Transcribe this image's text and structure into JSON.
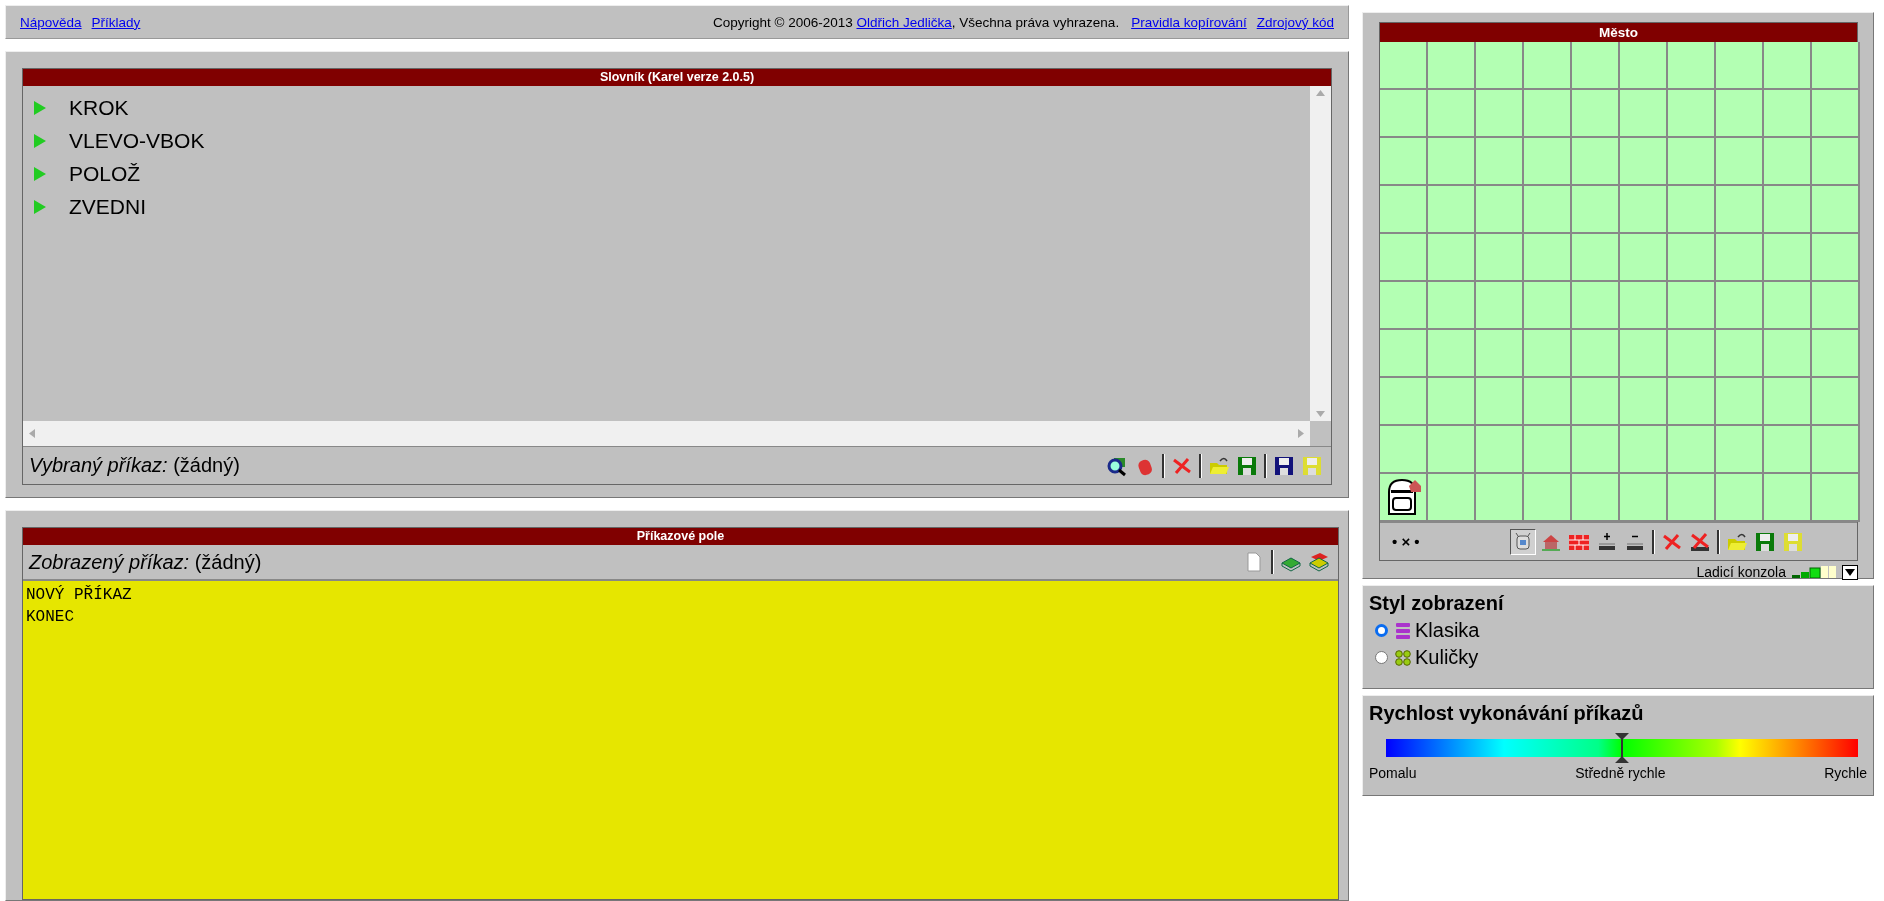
{
  "top_bar": {
    "links_left": [
      "Nápověda",
      "Příklady"
    ],
    "copyright_before": "Copyright © 2006-2013",
    "author_link": "Oldřich Jedlička",
    "copyright_after": ", Všechna práva vyhrazena.",
    "links_right": [
      "Pravidla kopírování",
      "Zdrojový kód"
    ]
  },
  "dictionary": {
    "title": "Slovník (Karel verze 2.0.5)",
    "items": [
      "KROK",
      "VLEVO-VBOK",
      "POLOŽ",
      "ZVEDNI"
    ],
    "selected_label": "*Vybraný příkaz:* (žádný)",
    "tools": [
      {
        "kind": "find"
      },
      {
        "kind": "eraser"
      },
      {
        "kind": "separator"
      },
      {
        "kind": "delete"
      },
      {
        "kind": "separator"
      },
      {
        "kind": "open"
      },
      {
        "kind": "save"
      },
      {
        "kind": "separator"
      },
      {
        "kind": "save-12"
      },
      {
        "kind": "save-k99"
      }
    ]
  },
  "command_field": {
    "title": "Příkazové pole",
    "shown_label": "*Zobrazený příkaz:* (žádný)",
    "tools": [
      {
        "kind": "new"
      },
      {
        "kind": "separator"
      },
      {
        "kind": "book"
      },
      {
        "kind": "books"
      }
    ],
    "value": "NOVÝ PŘÍKAZ\nKONEC"
  },
  "city": {
    "title": "Město",
    "position": "• × •",
    "tools": [
      {
        "kind": "robot",
        "selected": true
      },
      {
        "kind": "home",
        "selected": false
      },
      {
        "kind": "wall",
        "selected": false
      },
      {
        "kind": "mark-add",
        "selected": false
      },
      {
        "kind": "mark-remove",
        "selected": false
      },
      {
        "kind": "separator"
      },
      {
        "kind": "delete",
        "selected": false
      },
      {
        "kind": "delete-all",
        "selected": false
      },
      {
        "kind": "separator"
      },
      {
        "kind": "open",
        "selected": false
      },
      {
        "kind": "save",
        "selected": false
      },
      {
        "kind": "save-k99",
        "selected": false
      }
    ],
    "console_label": "Ladicí konzola"
  },
  "display_style": {
    "title": "Styl zobrazení",
    "options": [
      {
        "label": "Klasika",
        "kind": "classic",
        "selected": true
      },
      {
        "label": "Kuličky",
        "kind": "balls",
        "selected": false
      }
    ]
  },
  "speed": {
    "title": "Rychlost vykonávání příkazů",
    "level": 0.5,
    "labels": [
      "Pomalu",
      "Středně rychle",
      "Rychle"
    ]
  }
}
